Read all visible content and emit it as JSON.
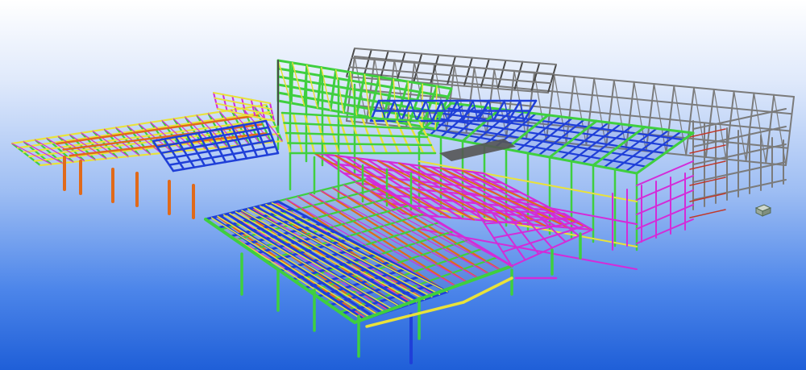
{
  "viewer": {
    "background_top": "#ffffff",
    "background_bottom": "#1f5fd8"
  },
  "model": {
    "member_colors": {
      "green": "#3fcf3f",
      "yellow": "#e9e23a",
      "blue": "#1f3fd8",
      "orange": "#e06a1a",
      "magenta": "#d42bd8",
      "grey": "#7b7b7b",
      "dark_grey": "#4a4a4a"
    },
    "icons": [
      "nav-cube-icon"
    ]
  }
}
